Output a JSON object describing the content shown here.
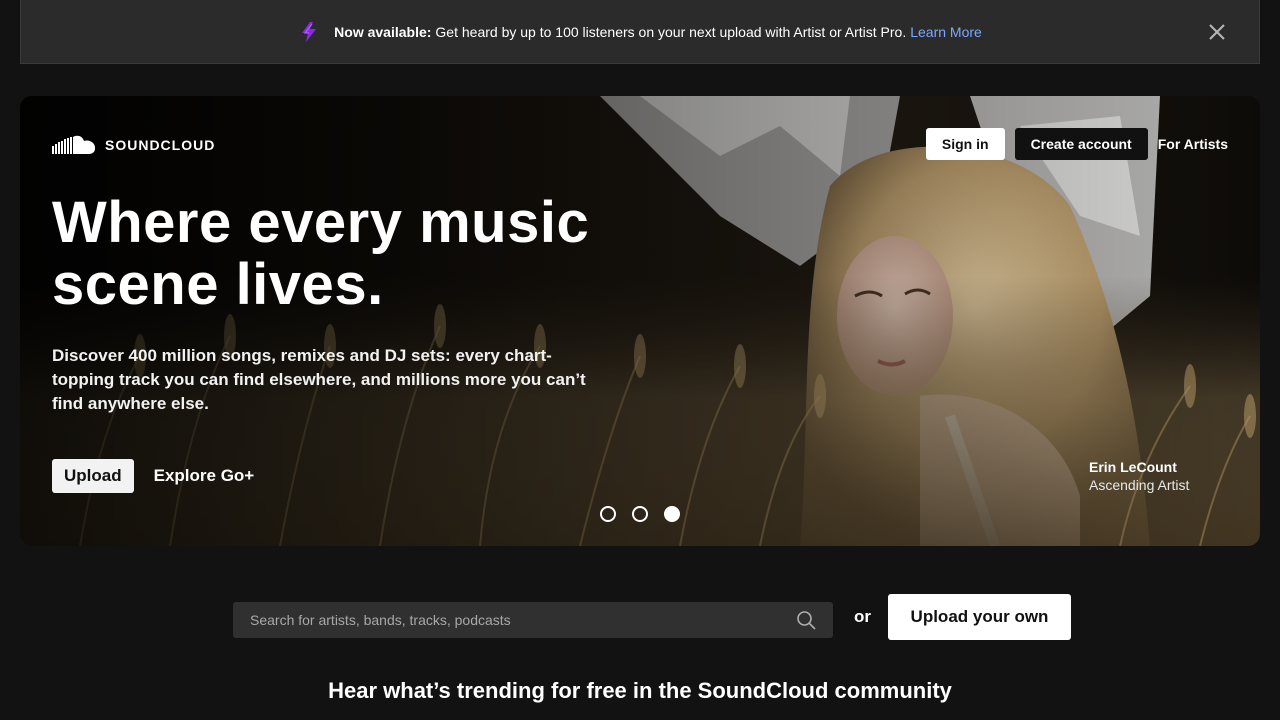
{
  "banner": {
    "strong": "Now available:",
    "text": "Get heard by up to 100 listeners on your next upload with Artist or Artist Pro.",
    "link": "Learn More",
    "icon": "lightning-bolt-icon",
    "icon_color": "#8a2be2"
  },
  "header": {
    "logo_text": "SOUNDCLOUD",
    "sign_in": "Sign in",
    "create_account": "Create account",
    "for_artists": "For Artists"
  },
  "hero": {
    "title_line1": "Where every music",
    "title_line2": "scene lives.",
    "description": "Discover 400 million songs, remixes and DJ sets: every chart-topping track you can find elsewhere, and millions more you can’t find anywhere else.",
    "upload_label": "Upload",
    "explore_label": "Explore Go+",
    "credit_name": "Erin LeCount",
    "credit_role": "Ascending Artist",
    "carousel_slide_count": 3,
    "carousel_active_index": 2
  },
  "search": {
    "placeholder": "Search for artists, bands, tracks, podcasts",
    "or_label": "or",
    "upload_own_label": "Upload your own"
  },
  "trending": {
    "heading": "Hear what’s trending for free in the SoundCloud community"
  },
  "colors": {
    "background": "#121212",
    "banner_bg": "#2b2b2b",
    "link": "#7aa8ff",
    "search_bg": "#303030"
  }
}
